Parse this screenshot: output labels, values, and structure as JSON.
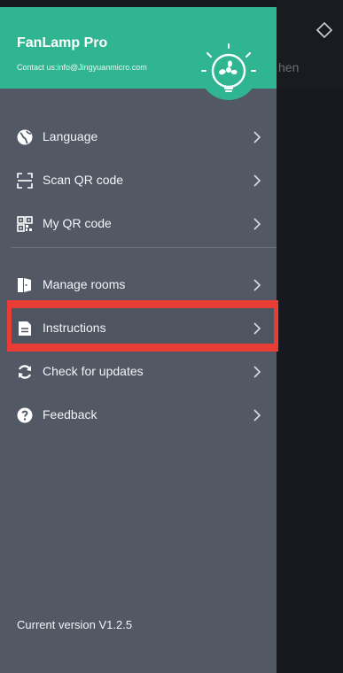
{
  "header": {
    "app_name": "FanLamp Pro",
    "contact": "Contact us:info@Jingyuanmicro.com"
  },
  "background": {
    "partial_text": "hen"
  },
  "menu": {
    "items": [
      {
        "label": "Language",
        "icon": "globe-icon"
      },
      {
        "label": "Scan QR code",
        "icon": "scan-icon"
      },
      {
        "label": "My QR code",
        "icon": "qr-code-icon"
      },
      {
        "label": "Manage rooms",
        "icon": "door-icon"
      },
      {
        "label": "Instructions",
        "icon": "document-icon"
      },
      {
        "label": "Check for updates",
        "icon": "refresh-icon"
      },
      {
        "label": "Feedback",
        "icon": "question-icon"
      }
    ]
  },
  "footer": {
    "version": "Current version V1.2.5"
  },
  "colors": {
    "header_bg": "#2fb592",
    "drawer_bg": "#535865",
    "highlight": "#e83d35"
  }
}
